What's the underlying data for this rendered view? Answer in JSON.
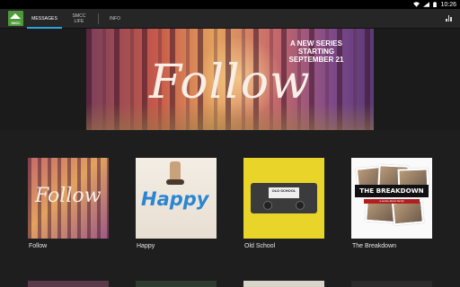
{
  "status_bar": {
    "time": "10:26"
  },
  "app": {
    "logo_text": "SMCC"
  },
  "tabs": [
    {
      "label": "MESSAGES",
      "active": true
    },
    {
      "label": "SMCC LIFE",
      "active": false
    },
    {
      "label": "INFO",
      "active": false
    }
  ],
  "banner": {
    "title": "Follow",
    "tagline": "A NEW SERIES STARTING SEPTEMBER 21"
  },
  "messages": [
    {
      "title": "Follow",
      "thumb_text": "Follow"
    },
    {
      "title": "Happy",
      "thumb_text": "Happy"
    },
    {
      "title": "Old School",
      "thumb_text": "OLD SCHOOL"
    },
    {
      "title": "The Breakdown",
      "thumb_text": "THE BREAKDOWN",
      "thumb_subtext": "a series about family"
    }
  ],
  "colors": {
    "accent": "#2aa5d8",
    "logo_green": "#4e9a3a",
    "background": "#1e1e1e"
  }
}
